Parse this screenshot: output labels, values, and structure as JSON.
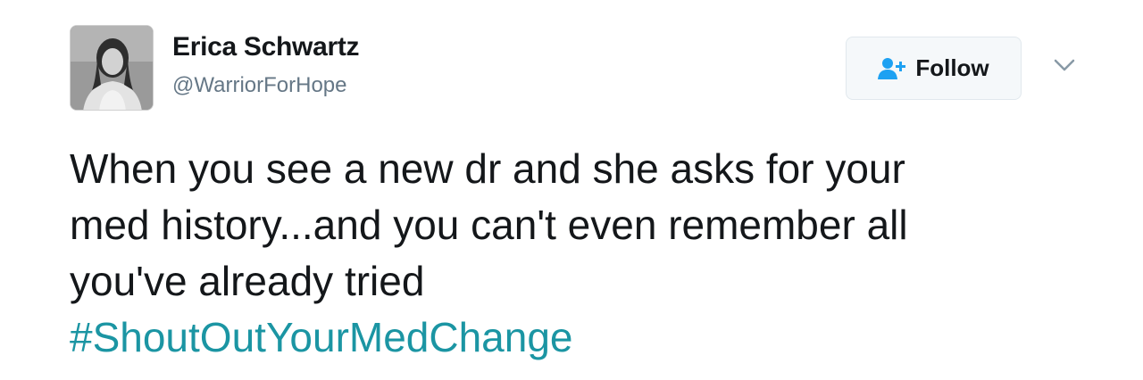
{
  "user": {
    "display_name": "Erica Schwartz",
    "handle": "@WarriorForHope",
    "avatar_icon": "profile-photo"
  },
  "follow_button": {
    "label": "Follow",
    "icon": "add-user-icon",
    "icon_color": "#1da1f2"
  },
  "menu": {
    "icon": "chevron-down-icon"
  },
  "tweet": {
    "lines": [
      "When you see a new dr and she asks for your",
      "med history...and you can't even remember all",
      "you've already tried"
    ],
    "hashtag": "#ShoutOutYourMedChange",
    "hashtag_color": "#1b95a3"
  }
}
